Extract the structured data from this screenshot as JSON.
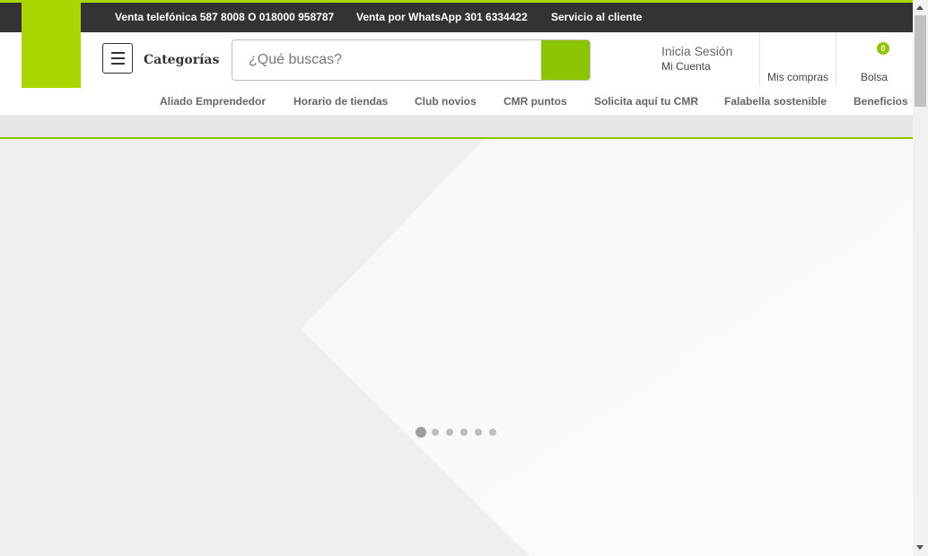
{
  "topbar": {
    "phone_sales": "Venta telefónica 587 8008 O 018000 958787",
    "whatsapp_sales": "Venta por WhatsApp 301 6334422",
    "customer_service": "Servicio al cliente"
  },
  "header": {
    "categories_label": "Categorías",
    "search_placeholder": "¿Qué buscas?",
    "login_title": "Inicia Sesión",
    "login_subtitle": "Mi Cuenta",
    "purchases_label": "Mis compras",
    "bag_label": "Bolsa",
    "bag_count": "0"
  },
  "nav": {
    "items": [
      "Aliado Emprendedor",
      "Horario de tiendas",
      "Club novios",
      "CMR puntos",
      "Solicita aquí tu CMR",
      "Falabella sostenible",
      "Beneficios"
    ]
  },
  "carousel": {
    "slide_count": 6,
    "active_index": 0
  },
  "colors": {
    "brand_green": "#aad500",
    "search_button": "#8bc400",
    "topbar": "#333333"
  }
}
